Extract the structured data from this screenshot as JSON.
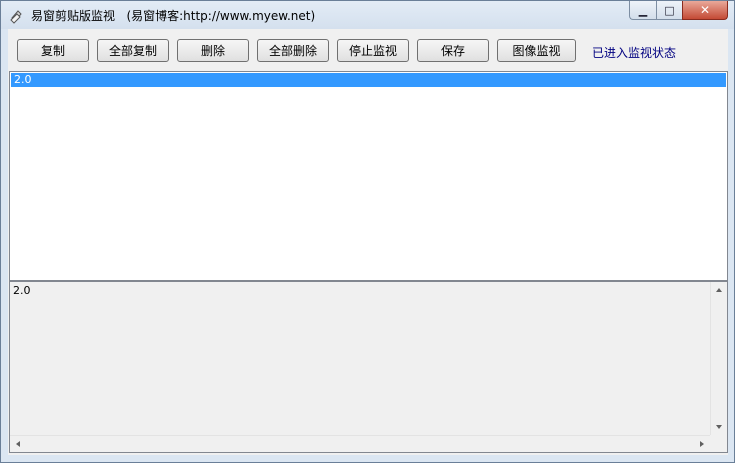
{
  "window": {
    "title": "易窗剪贴版监视   (易窗博客:http://www.myew.net)",
    "minimize_glyph": "▁",
    "maximize_glyph": "□",
    "close_glyph": "✕"
  },
  "toolbar": {
    "buttons": [
      {
        "label": "复制"
      },
      {
        "label": "全部复制"
      },
      {
        "label": "删除"
      },
      {
        "label": "全部删除"
      },
      {
        "label": "停止监视"
      },
      {
        "label": "保存"
      },
      {
        "label": "图像监视"
      }
    ],
    "status": "已进入监视状态"
  },
  "listbox": {
    "items": [
      {
        "text": "2.0",
        "selected": true
      }
    ]
  },
  "textarea": {
    "value": "2.0"
  },
  "colors": {
    "selection": "#3399ff",
    "status_text": "#000080",
    "close_button": "#c44a35"
  },
  "icons": [
    "app-clipboard-icon",
    "minimize-icon",
    "maximize-icon",
    "close-icon"
  ]
}
